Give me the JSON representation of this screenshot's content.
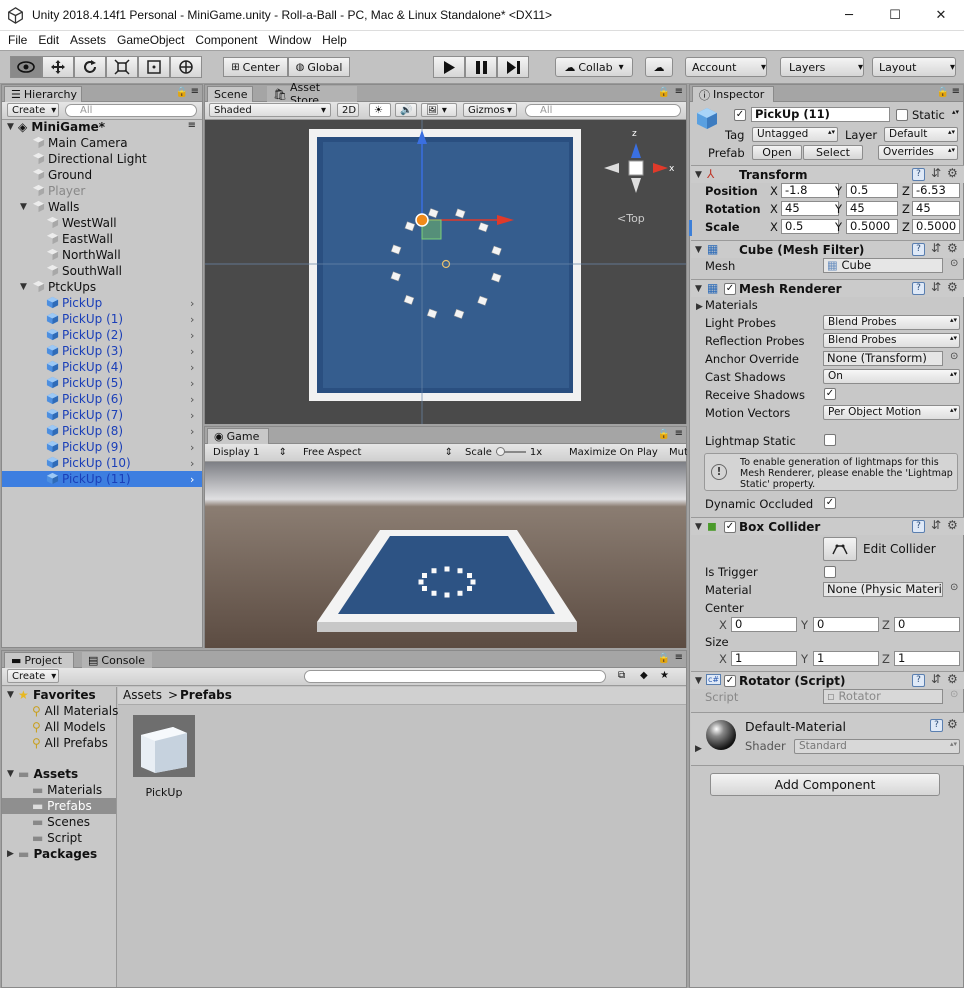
{
  "window": {
    "title": "Unity 2018.4.14f1 Personal - MiniGame.unity - Roll-a-Ball - PC, Mac & Linux Standalone* <DX11>",
    "minimize": "─",
    "maximize": "☐",
    "close": "✕"
  },
  "menu": [
    "File",
    "Edit",
    "Assets",
    "GameObject",
    "Component",
    "Window",
    "Help"
  ],
  "toolbar": {
    "center": "Center",
    "global": "Global",
    "collab": "Collab",
    "account": "Account",
    "layers": "Layers",
    "layout": "Layout"
  },
  "hierarchy": {
    "tab": "Hierarchy",
    "create": "Create",
    "search_placeholder": "All",
    "scene": "MiniGame*",
    "items": [
      "Main Camera",
      "Directional Light",
      "Ground",
      "Player",
      "Walls",
      "WestWall",
      "EastWall",
      "NorthWall",
      "SouthWall",
      "PtckUps",
      "PickUp",
      "PickUp (1)",
      "PickUp (2)",
      "PickUp (3)",
      "PickUp (4)",
      "PickUp (5)",
      "PickUp (6)",
      "PickUp (7)",
      "PickUp (8)",
      "PickUp (9)",
      "PickUp (10)",
      "PickUp (11)"
    ]
  },
  "scene": {
    "tab": "Scene",
    "tab2": "Asset Store",
    "shaded": "Shaded",
    "mode2d": "2D",
    "gizmos": "Gizmos",
    "search_placeholder": "All",
    "view_label": "Top",
    "axis_x": "x",
    "axis_z": "z"
  },
  "game": {
    "tab": "Game",
    "display": "Display 1",
    "aspect": "Free Aspect",
    "scale_label": "Scale",
    "scale_value": "1x",
    "maximize": "Maximize On Play",
    "mute": "Mut"
  },
  "project": {
    "tab": "Project",
    "tab2": "Console",
    "create": "Create",
    "favorites": "Favorites",
    "fav_items": [
      "All Materials",
      "All Models",
      "All Prefabs"
    ],
    "assets": "Assets",
    "asset_items": [
      "Materials",
      "Prefabs",
      "Scenes",
      "Script"
    ],
    "packages": "Packages",
    "breadcrumb_root": "Assets",
    "breadcrumb_sep": ">",
    "breadcrumb_current": "Prefabs",
    "asset_file": "PickUp"
  },
  "inspector": {
    "tab": "Inspector",
    "name": "PickUp (11)",
    "static_label": "Static",
    "tag_label": "Tag",
    "tag_value": "Untagged",
    "layer_label": "Layer",
    "layer_value": "Default",
    "prefab_label": "Prefab",
    "open": "Open",
    "select": "Select",
    "overrides": "Overrides",
    "transform": {
      "title": "Transform",
      "position_label": "Position",
      "rotation_label": "Rotation",
      "scale_label": "Scale",
      "x": "X",
      "y": "Y",
      "z": "Z",
      "position": [
        "-1.8",
        "0.5",
        "-6.53"
      ],
      "rotation": [
        "45",
        "45",
        "45"
      ],
      "scale": [
        "0.5",
        "0.5000",
        "0.5000"
      ]
    },
    "mesh_filter": {
      "title": "Cube (Mesh Filter)",
      "mesh_label": "Mesh",
      "mesh_value": "Cube"
    },
    "mesh_renderer": {
      "title": "Mesh Renderer",
      "materials": "Materials",
      "light_probes_label": "Light Probes",
      "light_probes": "Blend Probes",
      "reflection_probes_label": "Reflection Probes",
      "reflection_probes": "Blend Probes",
      "anchor_label": "Anchor Override",
      "anchor": "None (Transform)",
      "cast_label": "Cast Shadows",
      "cast": "On",
      "receive_label": "Receive Shadows",
      "motion_label": "Motion Vectors",
      "motion": "Per Object Motion",
      "lightmap_label": "Lightmap Static",
      "info": "To enable generation of lightmaps for this Mesh Renderer, please enable the 'Lightmap Static' property.",
      "dynamic_label": "Dynamic Occluded"
    },
    "box_collider": {
      "title": "Box Collider",
      "edit": "Edit Collider",
      "trigger_label": "Is Trigger",
      "material_label": "Material",
      "material": "None (Physic Materi",
      "center_label": "Center",
      "center": [
        "0",
        "0",
        "0"
      ],
      "size_label": "Size",
      "size": [
        "1",
        "1",
        "1"
      ]
    },
    "rotator": {
      "title": "Rotator (Script)",
      "script_label": "Script",
      "script": "Rotator"
    },
    "material": {
      "name": "Default-Material",
      "shader_label": "Shader",
      "shader": "Standard"
    },
    "add_component": "Add Component"
  }
}
